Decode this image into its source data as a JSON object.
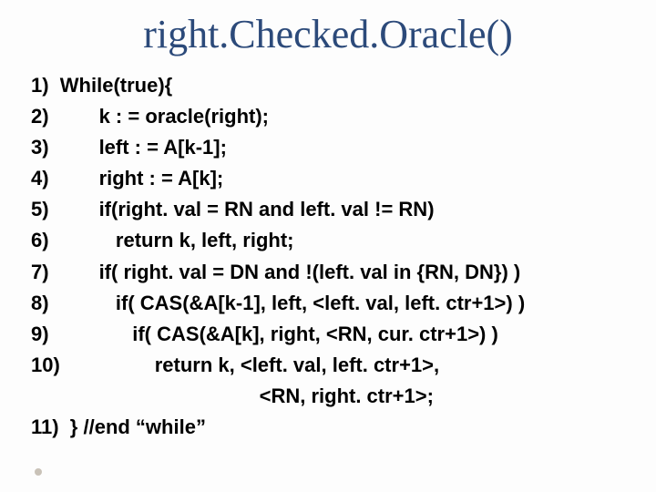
{
  "title": "right.Checked.Oracle()",
  "lines": {
    "l1": "1)  While(true){",
    "l2": "2)         k : = oracle(right);",
    "l3": "3)         left : = A[k-1];",
    "l4": "4)         right : = A[k];",
    "l5": "5)         if(right. val = RN and left. val != RN)",
    "l6": "6)            return k, left, right;",
    "l7": "7)         if( right. val = DN and !(left. val in {RN, DN}) )",
    "l8": "8)            if( CAS(&A[k-1], left, <left. val, left. ctr+1>) )",
    "l9": "9)               if( CAS(&A[k], right, <RN, cur. ctr+1>) )",
    "l10": "10)                 return k, <left. val, left. ctr+1>,",
    "l10b": "                                         <RN, right. ctr+1>;",
    "l11": "11)  } //end “while”"
  }
}
